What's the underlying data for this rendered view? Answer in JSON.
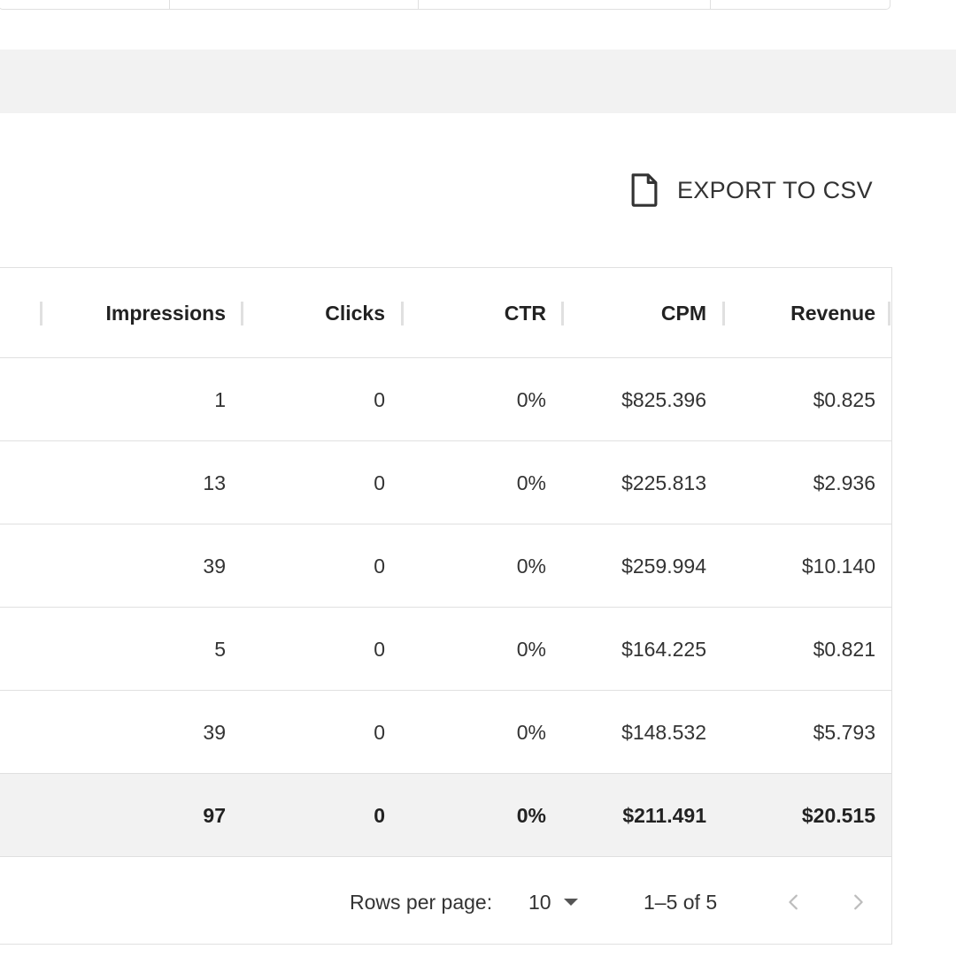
{
  "toolbar": {
    "export_label": "EXPORT TO CSV",
    "export_icon": "file-icon"
  },
  "table": {
    "columns": [
      "Impressions",
      "Clicks",
      "CTR",
      "CPM",
      "Revenue"
    ],
    "rows": [
      {
        "impressions": "1",
        "clicks": "0",
        "ctr": "0%",
        "cpm": "$825.396",
        "revenue": "$0.825"
      },
      {
        "impressions": "13",
        "clicks": "0",
        "ctr": "0%",
        "cpm": "$225.813",
        "revenue": "$2.936"
      },
      {
        "impressions": "39",
        "clicks": "0",
        "ctr": "0%",
        "cpm": "$259.994",
        "revenue": "$10.140"
      },
      {
        "impressions": "5",
        "clicks": "0",
        "ctr": "0%",
        "cpm": "$164.225",
        "revenue": "$0.821"
      },
      {
        "impressions": "39",
        "clicks": "0",
        "ctr": "0%",
        "cpm": "$148.532",
        "revenue": "$5.793"
      }
    ],
    "totals": {
      "impressions": "97",
      "clicks": "0",
      "ctr": "0%",
      "cpm": "$211.491",
      "revenue": "$20.515"
    }
  },
  "pagination": {
    "rows_per_page_label": "Rows per page:",
    "rows_per_page_value": "10",
    "range_label": "1–5 of 5",
    "prev_icon": "chevron-left-icon",
    "next_icon": "chevron-right-icon"
  },
  "colors": {
    "band": "#f2f2f2",
    "border": "#e0e0e0",
    "text": "#333333",
    "header_text": "#222222",
    "disabled_icon": "#bdbdbd"
  }
}
